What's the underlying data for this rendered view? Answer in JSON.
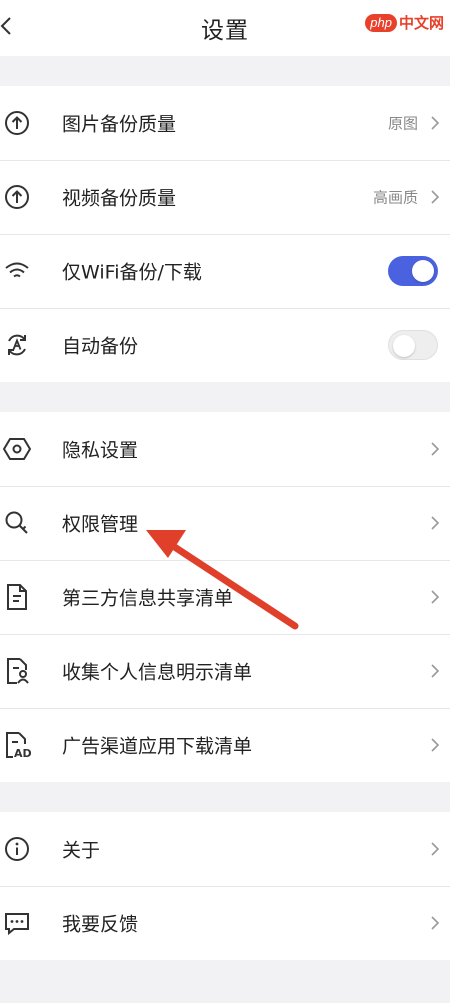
{
  "header": {
    "title": "设置",
    "watermark_logo": "php",
    "watermark_text": "中文网"
  },
  "groups": {
    "backup": {
      "image_quality": {
        "label": "图片备份质量",
        "value": "原图",
        "icon": "upload-icon"
      },
      "video_quality": {
        "label": "视频备份质量",
        "value": "高画质",
        "icon": "upload-icon"
      },
      "wifi_only": {
        "label": "仅WiFi备份/下载",
        "enabled": true,
        "icon": "wifi-icon"
      },
      "auto_backup": {
        "label": "自动备份",
        "enabled": false,
        "icon": "auto-sync-icon"
      }
    },
    "privacy": {
      "privacy_settings": {
        "label": "隐私设置",
        "icon": "hexagon-icon"
      },
      "permissions": {
        "label": "权限管理",
        "icon": "key-search-icon"
      },
      "third_party": {
        "label": "第三方信息共享清单",
        "icon": "document-list-icon"
      },
      "personal_info": {
        "label": "收集个人信息明示清单",
        "icon": "document-person-icon"
      },
      "ad_channel": {
        "label": "广告渠道应用下载清单",
        "icon": "document-ad-icon"
      }
    },
    "misc": {
      "about": {
        "label": "关于",
        "icon": "info-icon"
      },
      "feedback": {
        "label": "我要反馈",
        "icon": "chat-icon"
      }
    }
  },
  "colors": {
    "toggle_on": "#4a62e0",
    "annotation_arrow": "#e0402a"
  }
}
